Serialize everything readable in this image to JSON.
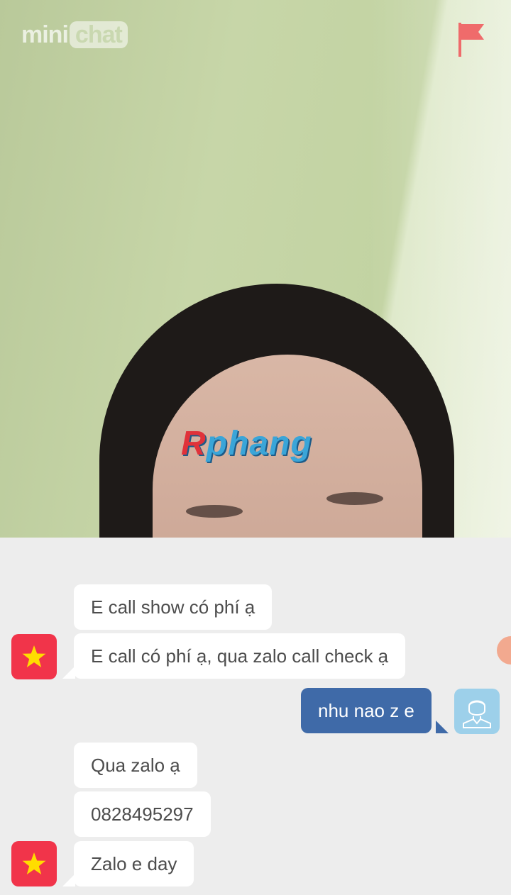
{
  "app": {
    "logo_part1": "mini",
    "logo_part2": "chat"
  },
  "video": {
    "watermark_first": "R",
    "watermark_rest": "phang"
  },
  "icons": {
    "report": "flag-icon",
    "partner_avatar": "vietnam-star-icon",
    "self_avatar": "user-outline-icon"
  },
  "colors": {
    "outgoing_bubble": "#3f6aa8",
    "partner_avatar_bg": "#f1344a",
    "self_avatar_bg": "#9dd0ea"
  },
  "messages": [
    {
      "from": "partner",
      "text": "E call show có phí ạ"
    },
    {
      "from": "partner",
      "text": "E call có phí ạ, qua zalo call check ạ"
    },
    {
      "from": "me",
      "text": "nhu nao z e"
    },
    {
      "from": "partner",
      "text": "Qua zalo ạ"
    },
    {
      "from": "partner",
      "text": "0828495297"
    },
    {
      "from": "partner",
      "text": "Zalo e day"
    }
  ]
}
